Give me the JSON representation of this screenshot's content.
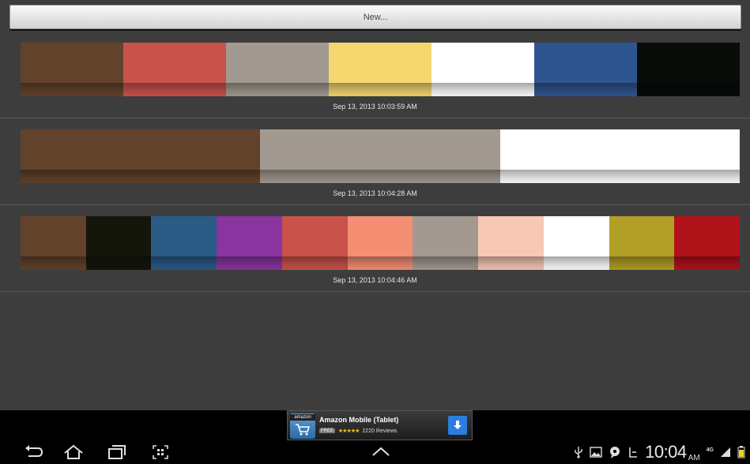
{
  "toolbar": {
    "new_label": "New..."
  },
  "palettes": [
    {
      "timestamp": "Sep 13, 2013 10:03:59 AM",
      "colors": [
        "#62422a",
        "#c9524b",
        "#a29a90",
        "#f4d76f",
        "#ffffff",
        "#2f5590",
        "#070c08"
      ]
    },
    {
      "timestamp": "Sep 13, 2013 10:04:28 AM",
      "colors": [
        "#62422a",
        "#a29a90",
        "#ffffff"
      ]
    },
    {
      "timestamp": "Sep 13, 2013 10:04:46 AM",
      "colors": [
        "#62422a",
        "#14150b",
        "#2a5a86",
        "#8a34a0",
        "#c9524b",
        "#f48f74",
        "#a29a90",
        "#f8c8b6",
        "#ffffff",
        "#b29f26",
        "#b0121a"
      ]
    }
  ],
  "ad": {
    "logo_text": "amazon",
    "title": "Amazon Mobile (Tablet)",
    "price_badge": "FREE",
    "stars": "★★★★★",
    "reviews": "2220 Reviews"
  },
  "status_bar": {
    "time": "10:04",
    "ampm": "AM",
    "network": "4G",
    "icons": [
      "usb-icon",
      "gallery-icon",
      "chat-icon",
      "alarm-icon",
      "signal-icon",
      "battery-icon"
    ]
  },
  "nav": {
    "icons": [
      "back-icon",
      "home-icon",
      "recent-apps-icon",
      "screenshot-icon",
      "up-arrow-icon"
    ]
  }
}
